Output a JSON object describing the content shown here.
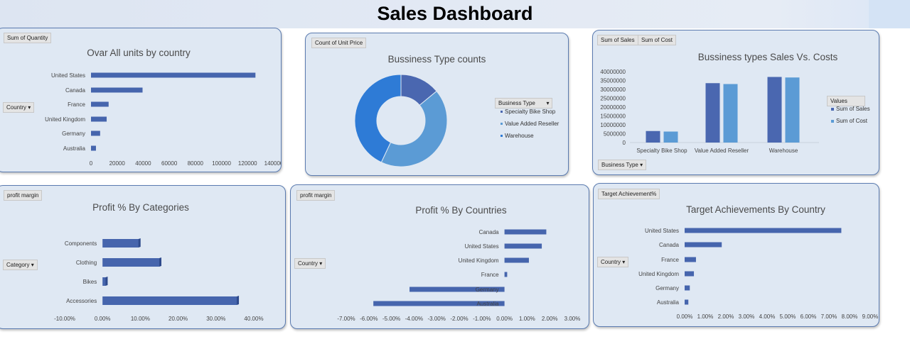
{
  "dashboard": {
    "title": "Sales Dashboard"
  },
  "colors": {
    "bar": "#4665ad",
    "bar_dark": "#2e4a8c",
    "sales": "#4a67b0",
    "cost": "#5b9bd5",
    "donut": [
      "#4a67b0",
      "#5b9bd5",
      "#2e7bd6"
    ]
  },
  "panels": [
    {
      "field_button": "Sum of Quantity",
      "row_button": "Country",
      "title": "Ovar All units by country"
    },
    {
      "field_button": "Count of Unit Price",
      "title": "Bussiness Type counts",
      "legend_button": "Business Type"
    },
    {
      "field_buttons": [
        "Sum of Sales",
        "Sum of Cost"
      ],
      "axis_button": "Business Type",
      "title": "Bussiness types Sales Vs. Costs",
      "legend_button": "Values"
    },
    {
      "field_button": "profit margin",
      "row_button": "Category",
      "title": "Profit % By Categories"
    },
    {
      "field_button": "profit margin",
      "row_button": "Country",
      "title": "Profit % By Countries"
    },
    {
      "field_button": "Target Achievement%",
      "row_button": "Country",
      "title": "Target Achievements By Country"
    }
  ],
  "chart_data": [
    {
      "type": "bar",
      "orientation": "horizontal",
      "title": "Ovar All units by country",
      "categories": [
        "United States",
        "Canada",
        "France",
        "United Kingdom",
        "Germany",
        "Australia"
      ],
      "values": [
        126000,
        39500,
        13500,
        12000,
        7000,
        3800
      ],
      "xlim": [
        0,
        140000
      ],
      "xticks": [
        "0",
        "20000",
        "40000",
        "60000",
        "80000",
        "100000",
        "120000",
        "140000"
      ],
      "grid": false
    },
    {
      "type": "pie",
      "hole": true,
      "title": "Bussiness Type counts",
      "labels": [
        "Specialty Bike Shop",
        "Value Added Reseller",
        "Warehouse"
      ],
      "values": [
        14,
        43,
        43
      ],
      "legend": "right"
    },
    {
      "type": "bar",
      "title": "Bussiness types Sales Vs. Costs",
      "categories": [
        "Specialty Bike Shop",
        "Value Added Reseller",
        "Warehouse"
      ],
      "series": [
        {
          "name": "Sum of Sales",
          "values": [
            6500000,
            33500000,
            37000000
          ]
        },
        {
          "name": "Sum of Cost",
          "values": [
            6200000,
            33000000,
            36700000
          ]
        }
      ],
      "ylim": [
        0,
        40000000
      ],
      "yticks": [
        "0",
        "5000000",
        "10000000",
        "15000000",
        "20000000",
        "25000000",
        "30000000",
        "35000000",
        "40000000"
      ],
      "legend": "right",
      "grid": false
    },
    {
      "type": "bar",
      "orientation": "horizontal",
      "title": "Profit % By Categories",
      "categories": [
        "Components",
        "Clothing",
        "Bikes",
        "Accessories"
      ],
      "values": [
        9.5,
        15.0,
        0.8,
        35.5
      ],
      "xlim": [
        -10,
        40
      ],
      "xticks": [
        "-10.00%",
        "0.00%",
        "10.00%",
        "20.00%",
        "30.00%",
        "40.00%"
      ],
      "grid": false
    },
    {
      "type": "bar",
      "orientation": "horizontal",
      "title": "Profit % By Countries",
      "categories": [
        "Canada",
        "United States",
        "United Kingdom",
        "France",
        "Germany",
        "Australia"
      ],
      "values": [
        1.85,
        1.65,
        1.08,
        0.12,
        -4.2,
        -5.8
      ],
      "xlim": [
        -7,
        3
      ],
      "xticks": [
        "-7.00%",
        "-6.00%",
        "-5.00%",
        "-4.00%",
        "-3.00%",
        "-2.00%",
        "-1.00%",
        "0.00%",
        "1.00%",
        "2.00%",
        "3.00%"
      ],
      "grid": false
    },
    {
      "type": "bar",
      "orientation": "horizontal",
      "title": "Target Achievements By Country",
      "categories": [
        "United States",
        "Canada",
        "France",
        "United Kingdom",
        "Germany",
        "Australia"
      ],
      "values": [
        7.6,
        1.8,
        0.55,
        0.45,
        0.25,
        0.18
      ],
      "xlim": [
        0,
        9
      ],
      "xticks": [
        "0.00%",
        "1.00%",
        "2.00%",
        "3.00%",
        "4.00%",
        "5.00%",
        "6.00%",
        "7.00%",
        "8.00%",
        "9.00%"
      ],
      "grid": false
    }
  ]
}
